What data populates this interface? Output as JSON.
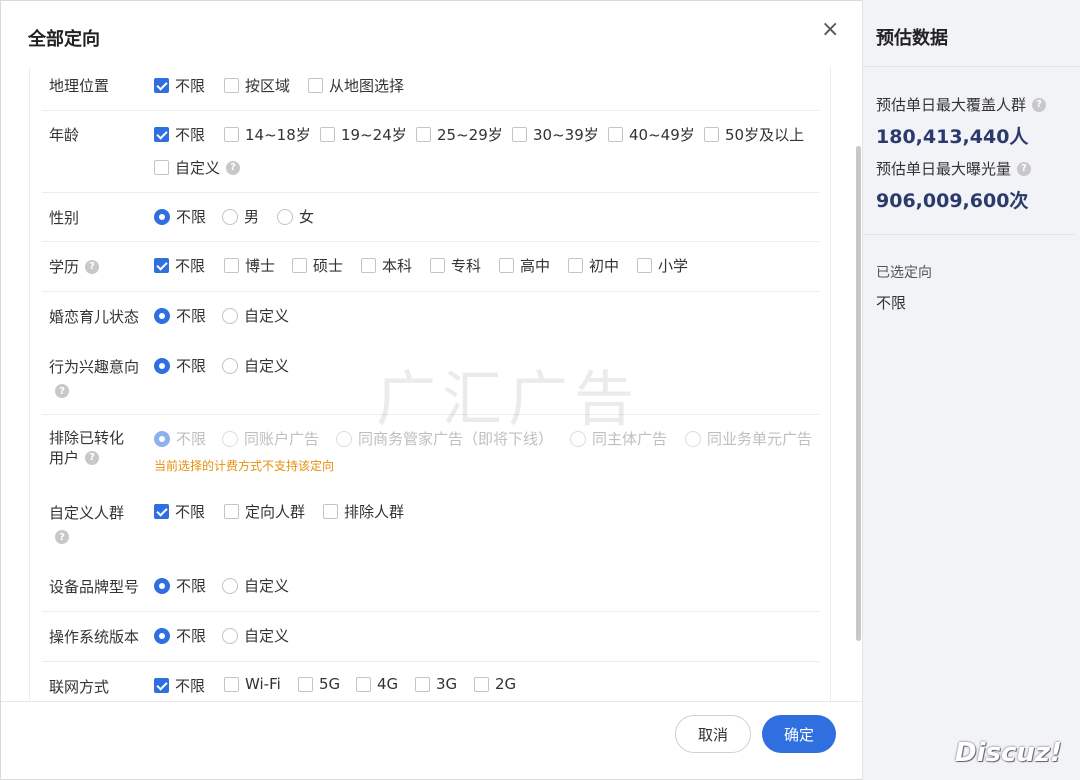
{
  "dialog": {
    "title": "全部定向",
    "close_glyph": "×",
    "cancel_label": "取消",
    "ok_label": "确定"
  },
  "rows": {
    "geo": {
      "label": "地理位置",
      "options": [
        "不限",
        "按区域",
        "从地图选择"
      ]
    },
    "age": {
      "label": "年龄",
      "options": [
        "不限",
        "14~18岁",
        "19~24岁",
        "25~29岁",
        "30~39岁",
        "40~49岁",
        "50岁及以上",
        "自定义"
      ]
    },
    "gender": {
      "label": "性别",
      "options": [
        "不限",
        "男",
        "女"
      ]
    },
    "edu": {
      "label": "学历",
      "options": [
        "不限",
        "博士",
        "硕士",
        "本科",
        "专科",
        "高中",
        "初中",
        "小学"
      ]
    },
    "marriage": {
      "label": "婚恋育儿状态",
      "options": [
        "不限",
        "自定义"
      ]
    },
    "interest": {
      "label": "行为兴趣意向",
      "options": [
        "不限",
        "自定义"
      ]
    },
    "exclude": {
      "label_line1": "排除已转化",
      "label_line2": "用户",
      "options": [
        "不限",
        "同账户广告",
        "同商务管家广告（即将下线）",
        "同主体广告",
        "同业务单元广告"
      ],
      "warning": "当前选择的计费方式不支持该定向"
    },
    "custom": {
      "label": "自定义人群",
      "options": [
        "不限",
        "定向人群",
        "排除人群"
      ]
    },
    "device": {
      "label": "设备品牌型号",
      "options": [
        "不限",
        "自定义"
      ]
    },
    "os": {
      "label": "操作系统版本",
      "options": [
        "不限",
        "自定义"
      ]
    },
    "network": {
      "label": "联网方式",
      "options": [
        "不限",
        "Wi-Fi",
        "5G",
        "4G",
        "3G",
        "2G"
      ]
    }
  },
  "side": {
    "title": "预估数据",
    "coverage_label": "预估单日最大覆盖人群",
    "coverage_value": "180,413,440人",
    "exposure_label": "预估单日最大曝光量",
    "exposure_value": "906,009,600次",
    "selected_label": "已选定向",
    "selected_value": "不限"
  },
  "help_glyph": "?",
  "watermark": "广汇广告",
  "discuz": "Discuz!",
  "colors": {
    "accent": "#2f6fe0",
    "warning": "#e6900a"
  }
}
